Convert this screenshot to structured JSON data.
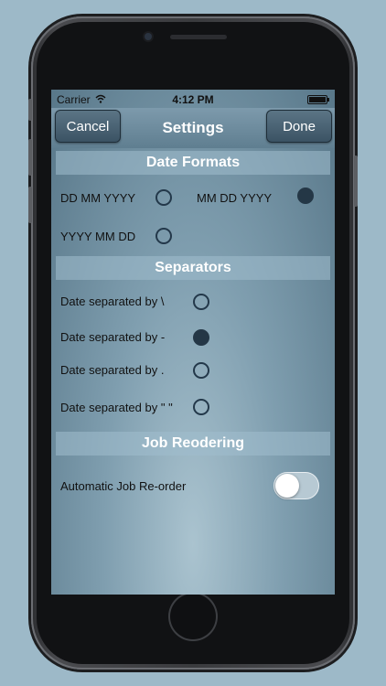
{
  "status": {
    "carrier": "Carrier",
    "time": "4:12 PM"
  },
  "nav": {
    "cancel_label": "Cancel",
    "title": "Settings",
    "done_label": "Done"
  },
  "date_formats": {
    "header": "Date Formats",
    "options": [
      {
        "label": "DD MM YYYY",
        "selected": false
      },
      {
        "label": "MM DD YYYY",
        "selected": true
      },
      {
        "label": "YYYY MM DD",
        "selected": false
      }
    ]
  },
  "separators": {
    "header": "Separators",
    "options": [
      {
        "label": "Date separated by \\",
        "selected": false
      },
      {
        "label": "Date separated by -",
        "selected": true
      },
      {
        "label": "Date separated by .",
        "selected": false
      },
      {
        "label": "Date separated by \" \"",
        "selected": false
      }
    ]
  },
  "job_reordering": {
    "header": "Job Reodering",
    "toggle_label": "Automatic Job Re-order",
    "enabled": false
  },
  "colors": {
    "background": "#9db9c8",
    "nav_button": "#3b5364",
    "radio_selected": "#243746"
  },
  "icons": {
    "wifi": "wifi-icon",
    "battery": "battery-icon"
  }
}
